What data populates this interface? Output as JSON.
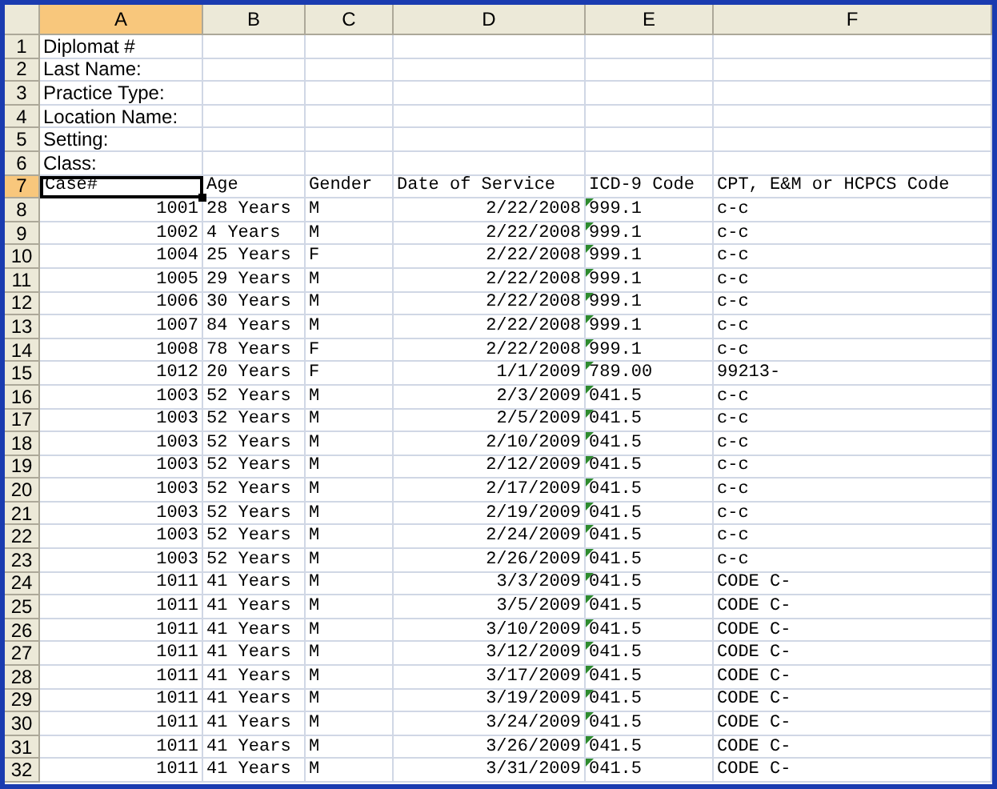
{
  "columns": [
    {
      "label": "A",
      "selected": true
    },
    {
      "label": "B",
      "selected": false
    },
    {
      "label": "C",
      "selected": false
    },
    {
      "label": "D",
      "selected": false
    },
    {
      "label": "E",
      "selected": false
    },
    {
      "label": "F",
      "selected": false
    }
  ],
  "rows": [
    {
      "n": "1",
      "kind": "label",
      "selected": false,
      "label": "Diplomat #"
    },
    {
      "n": "2",
      "kind": "label",
      "selected": false,
      "label": "Last Name:"
    },
    {
      "n": "3",
      "kind": "label",
      "selected": false,
      "label": "Practice Type:"
    },
    {
      "n": "4",
      "kind": "label",
      "selected": false,
      "label": "Location Name:"
    },
    {
      "n": "5",
      "kind": "label",
      "selected": false,
      "label": "Setting:"
    },
    {
      "n": "6",
      "kind": "label",
      "selected": false,
      "label": "Class:"
    },
    {
      "n": "7",
      "kind": "header",
      "selected": true,
      "cells": [
        "Case#",
        "Age",
        "Gender",
        "Date of Service",
        "ICD-9 Code",
        "CPT, E&M or HCPCS Code"
      ]
    },
    {
      "n": "8",
      "kind": "data",
      "selected": false,
      "flag": true,
      "cells": [
        "1001",
        "28 Years",
        "M",
        "2/22/2008",
        "999.1",
        "c-c"
      ]
    },
    {
      "n": "9",
      "kind": "data",
      "selected": false,
      "flag": true,
      "cells": [
        "1002",
        "4 Years",
        "M",
        "2/22/2008",
        "999.1",
        "c-c"
      ]
    },
    {
      "n": "10",
      "kind": "data",
      "selected": false,
      "flag": true,
      "cells": [
        "1004",
        "25 Years",
        "F",
        "2/22/2008",
        "999.1",
        "c-c"
      ]
    },
    {
      "n": "11",
      "kind": "data",
      "selected": false,
      "flag": true,
      "cells": [
        "1005",
        "29 Years",
        "M",
        "2/22/2008",
        "999.1",
        "c-c"
      ]
    },
    {
      "n": "12",
      "kind": "data",
      "selected": false,
      "flag": true,
      "cells": [
        "1006",
        "30 Years",
        "M",
        "2/22/2008",
        "999.1",
        "c-c"
      ]
    },
    {
      "n": "13",
      "kind": "data",
      "selected": false,
      "flag": true,
      "cells": [
        "1007",
        "84 Years",
        "M",
        "2/22/2008",
        "999.1",
        "c-c"
      ]
    },
    {
      "n": "14",
      "kind": "data",
      "selected": false,
      "flag": true,
      "cells": [
        "1008",
        "78 Years",
        "F",
        "2/22/2008",
        "999.1",
        "c-c"
      ]
    },
    {
      "n": "15",
      "kind": "data",
      "selected": false,
      "flag": true,
      "cells": [
        "1012",
        "20 Years",
        "F",
        "1/1/2009",
        "789.00",
        "99213-"
      ]
    },
    {
      "n": "16",
      "kind": "data",
      "selected": false,
      "flag": true,
      "cells": [
        "1003",
        "52 Years",
        "M",
        "2/3/2009",
        "041.5",
        "c-c"
      ]
    },
    {
      "n": "17",
      "kind": "data",
      "selected": false,
      "flag": true,
      "cells": [
        "1003",
        "52 Years",
        "M",
        "2/5/2009",
        "041.5",
        "c-c"
      ]
    },
    {
      "n": "18",
      "kind": "data",
      "selected": false,
      "flag": true,
      "cells": [
        "1003",
        "52 Years",
        "M",
        "2/10/2009",
        "041.5",
        "c-c"
      ]
    },
    {
      "n": "19",
      "kind": "data",
      "selected": false,
      "flag": true,
      "cells": [
        "1003",
        "52 Years",
        "M",
        "2/12/2009",
        "041.5",
        "c-c"
      ]
    },
    {
      "n": "20",
      "kind": "data",
      "selected": false,
      "flag": true,
      "cells": [
        "1003",
        "52 Years",
        "M",
        "2/17/2009",
        "041.5",
        "c-c"
      ]
    },
    {
      "n": "21",
      "kind": "data",
      "selected": false,
      "flag": true,
      "cells": [
        "1003",
        "52 Years",
        "M",
        "2/19/2009",
        "041.5",
        "c-c"
      ]
    },
    {
      "n": "22",
      "kind": "data",
      "selected": false,
      "flag": true,
      "cells": [
        "1003",
        "52 Years",
        "M",
        "2/24/2009",
        "041.5",
        "c-c"
      ]
    },
    {
      "n": "23",
      "kind": "data",
      "selected": false,
      "flag": true,
      "cells": [
        "1003",
        "52 Years",
        "M",
        "2/26/2009",
        "041.5",
        "c-c"
      ]
    },
    {
      "n": "24",
      "kind": "data",
      "selected": false,
      "flag": true,
      "cells": [
        "1011",
        "41 Years",
        "M",
        "3/3/2009",
        "041.5",
        "CODE C-"
      ]
    },
    {
      "n": "25",
      "kind": "data",
      "selected": false,
      "flag": true,
      "cells": [
        "1011",
        "41 Years",
        "M",
        "3/5/2009",
        "041.5",
        "CODE C-"
      ]
    },
    {
      "n": "26",
      "kind": "data",
      "selected": false,
      "flag": true,
      "cells": [
        "1011",
        "41 Years",
        "M",
        "3/10/2009",
        "041.5",
        "CODE C-"
      ]
    },
    {
      "n": "27",
      "kind": "data",
      "selected": false,
      "flag": true,
      "cells": [
        "1011",
        "41 Years",
        "M",
        "3/12/2009",
        "041.5",
        "CODE C-"
      ]
    },
    {
      "n": "28",
      "kind": "data",
      "selected": false,
      "flag": true,
      "cells": [
        "1011",
        "41 Years",
        "M",
        "3/17/2009",
        "041.5",
        "CODE C-"
      ]
    },
    {
      "n": "29",
      "kind": "data",
      "selected": false,
      "flag": true,
      "cells": [
        "1011",
        "41 Years",
        "M",
        "3/19/2009",
        "041.5",
        "CODE C-"
      ]
    },
    {
      "n": "30",
      "kind": "data",
      "selected": false,
      "flag": true,
      "cells": [
        "1011",
        "41 Years",
        "M",
        "3/24/2009",
        "041.5",
        "CODE C-"
      ]
    },
    {
      "n": "31",
      "kind": "data",
      "selected": false,
      "flag": true,
      "cells": [
        "1011",
        "41 Years",
        "M",
        "3/26/2009",
        "041.5",
        "CODE C-"
      ]
    },
    {
      "n": "32",
      "kind": "data",
      "selected": false,
      "flag": true,
      "cells": [
        "1011",
        "41 Years",
        "M",
        "3/31/2009",
        "041.5",
        "CODE C-"
      ]
    }
  ]
}
